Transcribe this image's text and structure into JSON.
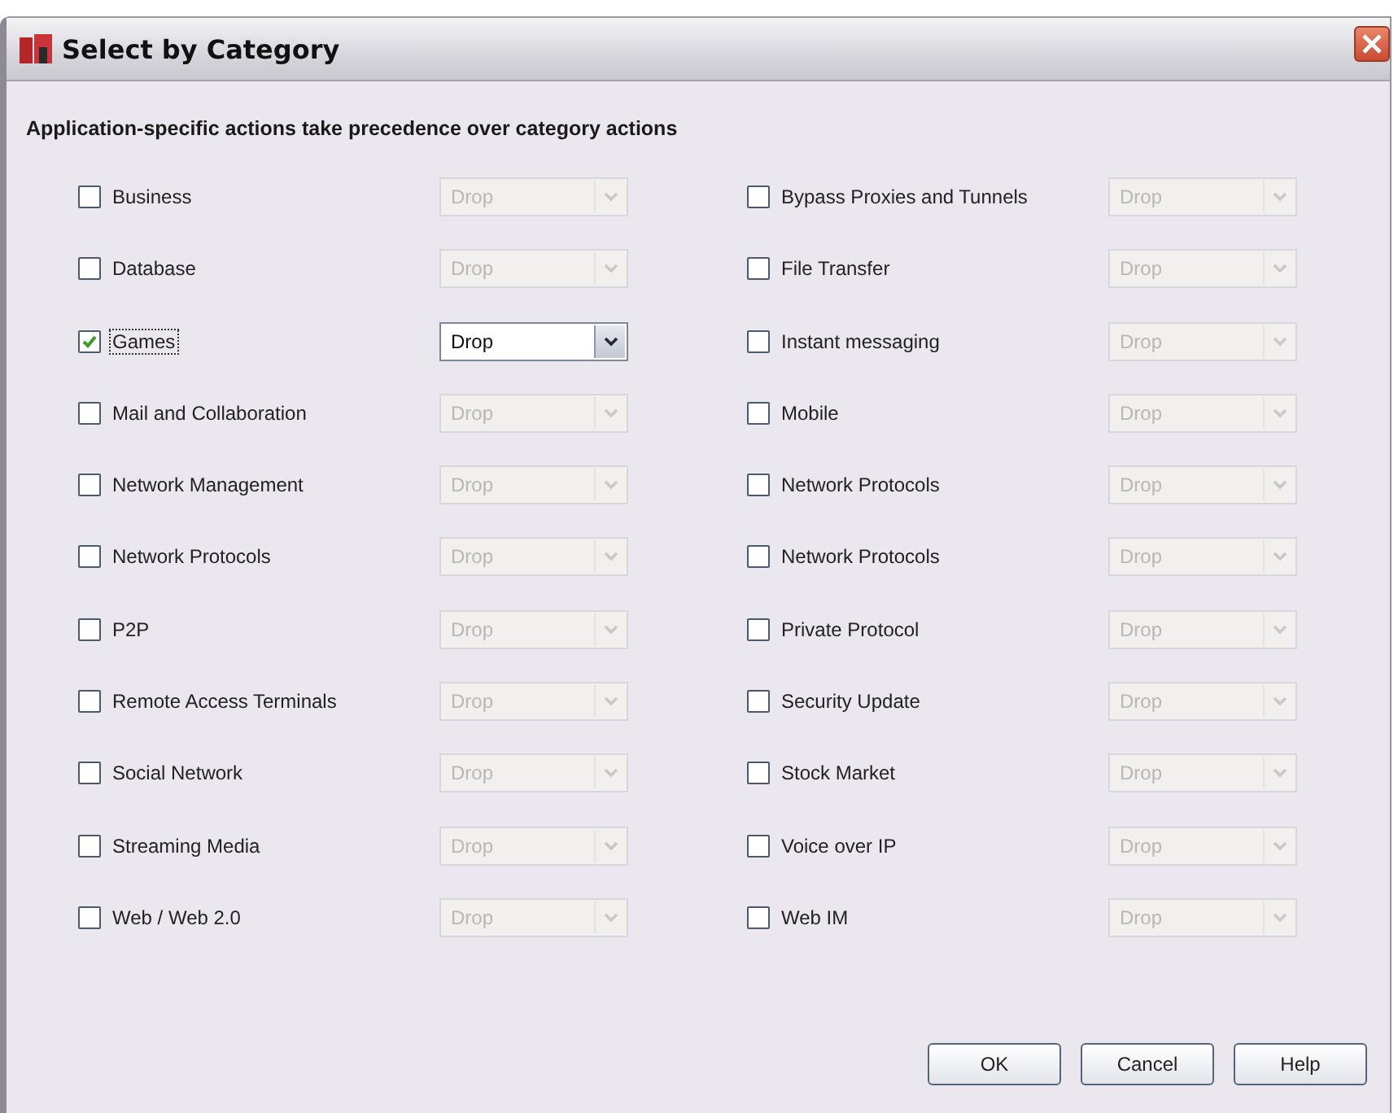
{
  "window": {
    "title": "Select by Category"
  },
  "note": "Application-specific actions take precedence over category actions",
  "columns": [
    {
      "categories": [
        {
          "label": "Business",
          "checked": false,
          "focused": false,
          "action": "Drop"
        },
        {
          "label": "Database",
          "checked": false,
          "focused": false,
          "action": "Drop"
        },
        {
          "label": "Games",
          "checked": true,
          "focused": true,
          "action": "Drop"
        },
        {
          "label": "Mail and Collaboration",
          "checked": false,
          "focused": false,
          "action": "Drop"
        },
        {
          "label": "Network Management",
          "checked": false,
          "focused": false,
          "action": "Drop"
        },
        {
          "label": "Network Protocols",
          "checked": false,
          "focused": false,
          "action": "Drop"
        },
        {
          "label": "P2P",
          "checked": false,
          "focused": false,
          "action": "Drop"
        },
        {
          "label": "Remote Access Terminals",
          "checked": false,
          "focused": false,
          "action": "Drop"
        },
        {
          "label": "Social Network",
          "checked": false,
          "focused": false,
          "action": "Drop"
        },
        {
          "label": "Streaming Media",
          "checked": false,
          "focused": false,
          "action": "Drop"
        },
        {
          "label": "Web / Web 2.0",
          "checked": false,
          "focused": false,
          "action": "Drop"
        }
      ]
    },
    {
      "categories": [
        {
          "label": "Bypass Proxies and Tunnels",
          "checked": false,
          "focused": false,
          "action": "Drop"
        },
        {
          "label": "File Transfer",
          "checked": false,
          "focused": false,
          "action": "Drop"
        },
        {
          "label": "Instant messaging",
          "checked": false,
          "focused": false,
          "action": "Drop"
        },
        {
          "label": "Mobile",
          "checked": false,
          "focused": false,
          "action": "Drop"
        },
        {
          "label": "Network Protocols",
          "checked": false,
          "focused": false,
          "action": "Drop"
        },
        {
          "label": "Network Protocols",
          "checked": false,
          "focused": false,
          "action": "Drop"
        },
        {
          "label": "Private Protocol",
          "checked": false,
          "focused": false,
          "action": "Drop"
        },
        {
          "label": "Security Update",
          "checked": false,
          "focused": false,
          "action": "Drop"
        },
        {
          "label": "Stock Market",
          "checked": false,
          "focused": false,
          "action": "Drop"
        },
        {
          "label": "Voice over IP",
          "checked": false,
          "focused": false,
          "action": "Drop"
        },
        {
          "label": "Web IM",
          "checked": false,
          "focused": false,
          "action": "Drop"
        }
      ]
    }
  ],
  "buttons": [
    "OK",
    "Cancel",
    "Help"
  ]
}
